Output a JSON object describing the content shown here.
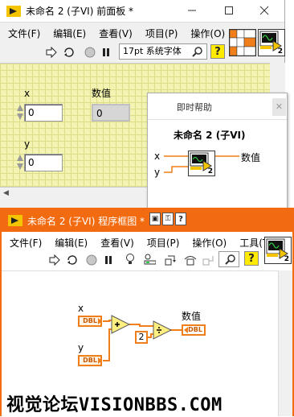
{
  "front_panel": {
    "title": "未命名 2 (子VI) 前面板 *",
    "menu": [
      "文件(F)",
      "编辑(E)",
      "查看(V)",
      "项目(P)",
      "操作(O)"
    ],
    "font_select": "17pt 系统字体",
    "connector_num": "2",
    "controls": {
      "x_label": "x",
      "x_value": "0",
      "y_label": "y",
      "y_value": "0",
      "out_label": "数值",
      "out_value": "0"
    }
  },
  "context_help": {
    "title": "即时帮助",
    "vi_name": "未命名 2 (子VI)",
    "terminal_x": "x",
    "terminal_y": "y",
    "terminal_out": "数值",
    "icon_num": "2"
  },
  "block_diagram": {
    "title": "未命名 2 (子VI) 程序框图 *",
    "menu": [
      "文件(F)",
      "编辑(E)",
      "查看(V)",
      "项目(P)",
      "操作(O)",
      "工具(T)"
    ],
    "icon_num": "2",
    "x_label": "x",
    "y_label": "y",
    "out_label": "数值",
    "dbl_text": "DBL",
    "constant": "2"
  },
  "watermark": "视觉论坛VISIONBBS.COM",
  "colors": {
    "grid_bg": "#f4f4b2",
    "bd_title": "#f26b10",
    "wire": "#f07e1a"
  },
  "icons": [
    "run-arrow-icon",
    "run-continuous-icon",
    "abort-icon",
    "pause-icon",
    "search-icon",
    "help-icon",
    "highlight-bulb-icon",
    "probe-icon",
    "step-into-icon",
    "step-over-icon",
    "step-out-icon",
    "minimize-icon",
    "maximize-icon",
    "close-icon"
  ]
}
